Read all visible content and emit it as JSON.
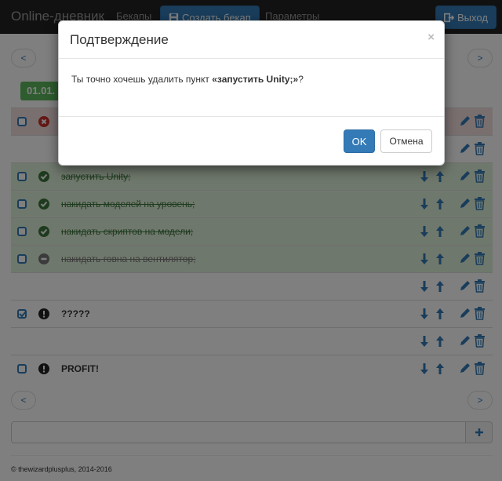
{
  "navbar": {
    "brand": "Online-дневник",
    "backups_link": "Бекапы",
    "create_backup_label": "Создать бекап",
    "params_link": "Параметры",
    "logout_label": "Выход"
  },
  "pager": {
    "prev": "<",
    "next": ">"
  },
  "date_badge": "01.01.",
  "items": [
    {
      "text": "",
      "status": "error",
      "checked": false
    },
    {
      "text": "",
      "status": "none",
      "checked": false
    },
    {
      "text": "запустить Unity;",
      "status": "done",
      "checked": false
    },
    {
      "text": "накидать моделей на уровень;",
      "status": "done",
      "checked": false
    },
    {
      "text": "накидать скриптов на модели;",
      "status": "done",
      "checked": false
    },
    {
      "text": "накидать говна на вентилятор;",
      "status": "canceled",
      "checked": false
    },
    {
      "text": "",
      "status": "none",
      "checked": false
    },
    {
      "text": "?????",
      "status": "important",
      "checked": true
    },
    {
      "text": "",
      "status": "none",
      "checked": false
    },
    {
      "text": "PROFIT!",
      "status": "important",
      "checked": false
    }
  ],
  "new_item": {
    "placeholder": "",
    "add_label": "+"
  },
  "footer": "© thewizardplusplus, 2014-2016",
  "modal": {
    "title": "Подтверждение",
    "close": "×",
    "question_prefix": "Ты точно хочешь удалить пункт ",
    "item_name": "«запустить Unity;»",
    "question_suffix": "?",
    "ok_label": "OK",
    "cancel_label": "Отмена"
  },
  "colors": {
    "primary": "#337ab7",
    "success": "#5cb85c",
    "danger_bg": "#f2dede",
    "success_bg": "#dff0d8"
  }
}
